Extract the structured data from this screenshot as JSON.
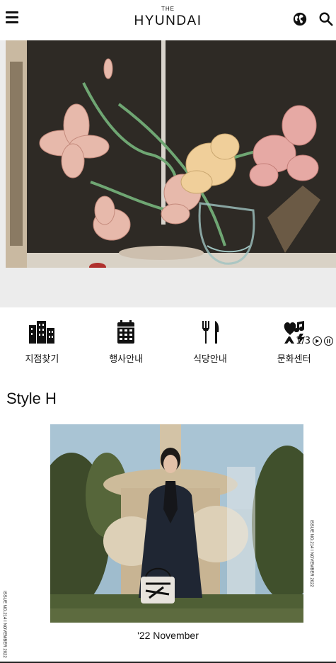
{
  "header": {
    "logo_top": "THE",
    "logo_main": "HYUNDAI",
    "menu_icon": "hamburger-icon",
    "globe_icon": "globe-icon",
    "search_icon": "search-icon"
  },
  "hero": {
    "pager_text": "1/3",
    "play_icon": "play-icon",
    "pause_icon": "pause-icon"
  },
  "quick_menu": [
    {
      "label": "지점찾기",
      "icon": "building-icon"
    },
    {
      "label": "행사안내",
      "icon": "calendar-icon"
    },
    {
      "label": "식당안내",
      "icon": "fork-knife-icon"
    },
    {
      "label": "문화센터",
      "icon": "culture-icon"
    }
  ],
  "style_h": {
    "title": "Style H",
    "side_text": "ISSUE NO.214 I NOVEMBER 2022",
    "caption": "'22 November"
  }
}
